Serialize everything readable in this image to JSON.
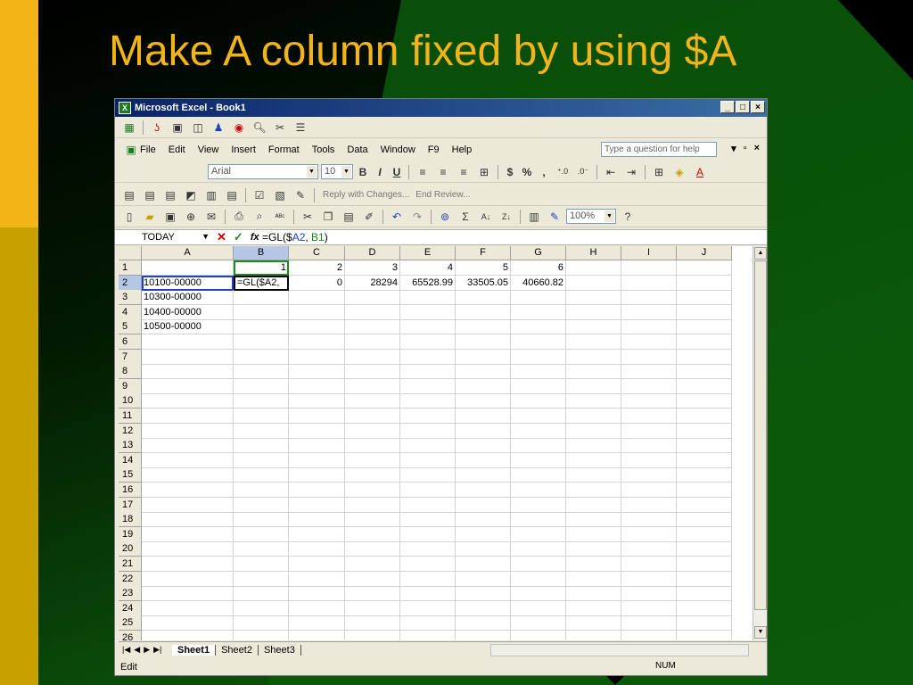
{
  "slide": {
    "title": "Make A column fixed by using $A"
  },
  "window": {
    "title": "Microsoft Excel - Book1",
    "minimize": "_",
    "maximize": "□",
    "close": "×"
  },
  "menu": {
    "items": [
      "File",
      "Edit",
      "View",
      "Insert",
      "Format",
      "Tools",
      "Data",
      "Window",
      "F9",
      "Help"
    ],
    "help_placeholder": "Type a question for help"
  },
  "format_toolbar": {
    "font": "Arial",
    "size": "10",
    "bold": "B",
    "italic": "I",
    "underline": "U",
    "currency": "$",
    "percent": "%",
    "comma": ","
  },
  "review_toolbar": {
    "reply": "Reply with Changes...",
    "end_review": "End Review..."
  },
  "standard_toolbar": {
    "zoom": "100%"
  },
  "formula_bar": {
    "name_box": "TODAY",
    "formula_prefix": "=GL($",
    "formula_ref_a": "A2",
    "formula_sep": ", ",
    "formula_ref_b": "B1",
    "formula_suffix": ")"
  },
  "grid": {
    "columns": [
      "A",
      "B",
      "C",
      "D",
      "E",
      "F",
      "G",
      "H",
      "I",
      "J"
    ],
    "rows": [
      {
        "n": "1",
        "cells": [
          "",
          "1",
          "2",
          "3",
          "4",
          "5",
          "6",
          "",
          "",
          ""
        ]
      },
      {
        "n": "2",
        "cells": [
          "10100-00000",
          "=GL($A2,",
          "0",
          "28294",
          "65528.99",
          "33505.05",
          "40660.82",
          "",
          "",
          ""
        ]
      },
      {
        "n": "3",
        "cells": [
          "10300-00000",
          "",
          "",
          "",
          "",
          "",
          "",
          "",
          "",
          ""
        ]
      },
      {
        "n": "4",
        "cells": [
          "10400-00000",
          "",
          "",
          "",
          "",
          "",
          "",
          "",
          "",
          ""
        ]
      },
      {
        "n": "5",
        "cells": [
          "10500-00000",
          "",
          "",
          "",
          "",
          "",
          "",
          "",
          "",
          ""
        ]
      },
      {
        "n": "6",
        "cells": []
      },
      {
        "n": "7",
        "cells": []
      },
      {
        "n": "8",
        "cells": []
      },
      {
        "n": "9",
        "cells": []
      },
      {
        "n": "10",
        "cells": []
      },
      {
        "n": "11",
        "cells": []
      },
      {
        "n": "12",
        "cells": []
      },
      {
        "n": "13",
        "cells": []
      },
      {
        "n": "14",
        "cells": []
      },
      {
        "n": "15",
        "cells": []
      },
      {
        "n": "16",
        "cells": []
      },
      {
        "n": "17",
        "cells": []
      },
      {
        "n": "18",
        "cells": []
      },
      {
        "n": "19",
        "cells": []
      },
      {
        "n": "20",
        "cells": []
      },
      {
        "n": "21",
        "cells": []
      },
      {
        "n": "22",
        "cells": []
      },
      {
        "n": "23",
        "cells": []
      },
      {
        "n": "24",
        "cells": []
      },
      {
        "n": "25",
        "cells": []
      },
      {
        "n": "26",
        "cells": []
      }
    ]
  },
  "sheets": [
    "Sheet1",
    "Sheet2",
    "Sheet3"
  ],
  "status": {
    "mode": "Edit",
    "num": "NUM"
  }
}
